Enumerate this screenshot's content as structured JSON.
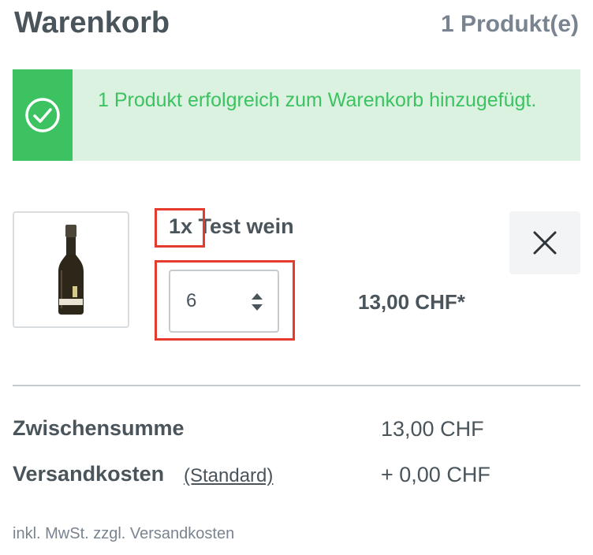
{
  "header": {
    "title": "Warenkorb",
    "count": "1 Produkt(e)"
  },
  "alert": {
    "message": "1 Produkt erfolgreich zum Warenkorb hinzugefügt.",
    "icon": "check-circle-icon",
    "color": "#3cc261"
  },
  "cart_item": {
    "name": "1x Test wein",
    "quantity": "6",
    "price": "13,00 CHF*",
    "image_icon": "wine-bottle-image",
    "remove_icon": "close-icon"
  },
  "summary": {
    "subtotal_label": "Zwischensumme",
    "subtotal_value": "13,00 CHF",
    "shipping_label": "Versandkosten",
    "shipping_method": "(Standard)",
    "shipping_value": "+ 0,00 CHF",
    "footnote": "inkl. MwSt. zzgl. Versandkosten"
  },
  "colors": {
    "success": "#3cc261",
    "success_bg": "#dbf2e1",
    "highlight": "#e53b2f",
    "text": "#4a545b"
  }
}
